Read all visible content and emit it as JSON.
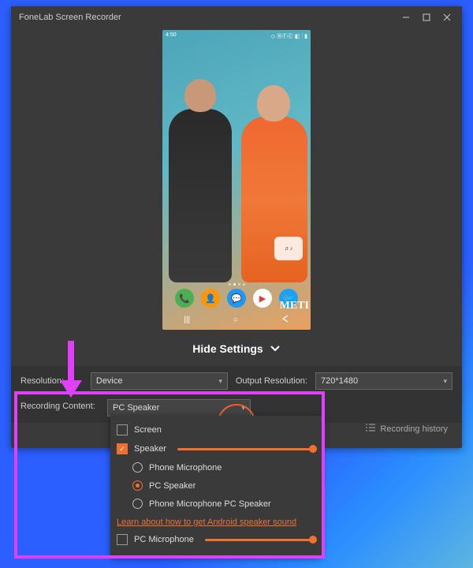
{
  "window": {
    "title": "FoneLab Screen Recorder"
  },
  "preview": {
    "status_time": "4:50",
    "status_icons": "▼ ♡ ⚙ ●",
    "status_right": "◇ ⓃⒻⒸ ◧ ⫶ ▮",
    "widget": "♬♪",
    "dock": {
      "phone": "📞",
      "contacts": "👤",
      "messages": "💬",
      "play": "▶",
      "twitter": "🐦"
    },
    "nav": {
      "recent": "|||",
      "home": "○",
      "back": "◁"
    },
    "badge": "METI"
  },
  "hide_settings_label": "Hide Settings",
  "settings": {
    "resolution_label": "Resolution:",
    "resolution_value": "Device",
    "output_label": "Output Resolution:",
    "output_value": "720*1480",
    "recording_label": "Recording Content:",
    "recording_value": "PC Speaker"
  },
  "dropdown": {
    "screen": "Screen",
    "speaker": "Speaker",
    "phone_mic": "Phone Microphone",
    "pc_speaker": "PC Speaker",
    "phone_mic_pc_speaker": "Phone Microphone  PC Speaker",
    "learn_link": "Learn about how to get Android speaker sound",
    "pc_microphone": "PC Microphone"
  },
  "history_label": "Recording history"
}
